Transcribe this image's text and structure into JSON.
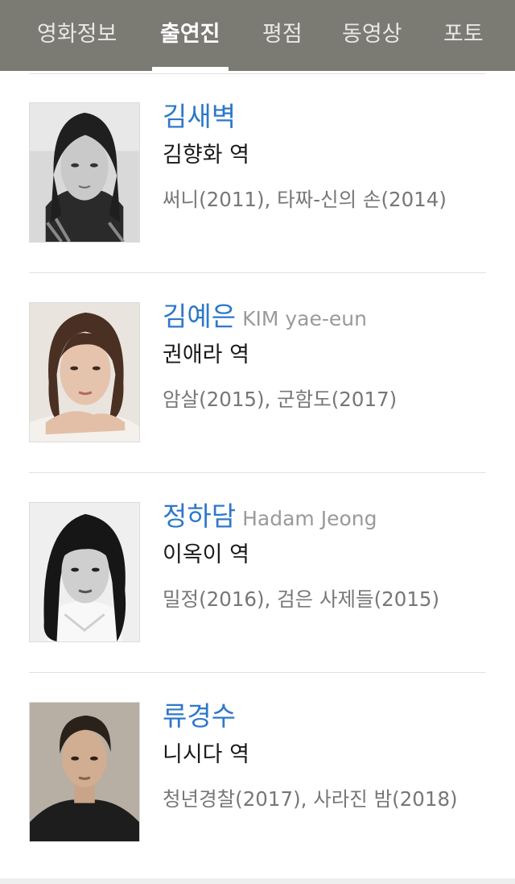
{
  "tabs": [
    {
      "label": "영화정보",
      "active": false
    },
    {
      "label": "출연진",
      "active": true
    },
    {
      "label": "평점",
      "active": false
    },
    {
      "label": "동영상",
      "active": false
    },
    {
      "label": "포토",
      "active": false
    }
  ],
  "cast": [
    {
      "name": "김새벽",
      "english_name": "",
      "role": "김향화 역",
      "films": "써니(2011), 타짜-신의 손(2014)"
    },
    {
      "name": "김예은",
      "english_name": "KIM yae-eun",
      "role": "권애라 역",
      "films": "암살(2015), 군함도(2017)"
    },
    {
      "name": "정하담",
      "english_name": "Hadam Jeong",
      "role": "이옥이 역",
      "films": "밀정(2016), 검은 사제들(2015)"
    },
    {
      "name": "류경수",
      "english_name": "",
      "role": "니시다 역",
      "films": "청년경찰(2017), 사라진 밤(2018)"
    }
  ],
  "colors": {
    "tab_bar": "#7b7a73",
    "name_link": "#2e78c9"
  }
}
